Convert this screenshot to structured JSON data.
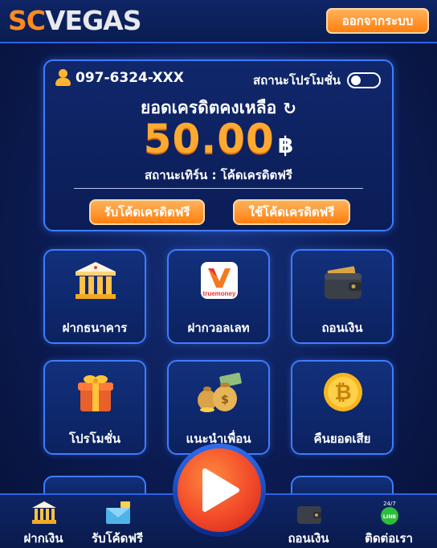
{
  "header": {
    "logo_sc": "SC",
    "logo_vegas": "VEGAS",
    "logout_label": "ออกจากระบบ"
  },
  "account": {
    "phone": "097-6324-XXX",
    "promo_label": "สถานะโปรโมชั่น",
    "promo_enabled": false,
    "credit_title": "ยอดเครดิตคงเหลือ",
    "balance": "50.00",
    "currency": "฿",
    "status_text": "สถานะเทิร์น : โค้ดเครดิตฟรี",
    "get_code_label": "รับโค้ดเครดิตฟรี",
    "use_code_label": "ใช้โค้ดเครดิตฟรี"
  },
  "menu": [
    {
      "label": "ฝากธนาคาร",
      "icon": "bank-icon"
    },
    {
      "label": "ฝากวอลเลท",
      "icon": "truemoney-icon",
      "icon_text": "truemoney"
    },
    {
      "label": "ถอนเงิน",
      "icon": "wallet-icon"
    },
    {
      "label": "โปรโมชั่น",
      "icon": "gift-icon"
    },
    {
      "label": "แนะนำเพื่อน",
      "icon": "money-bags-icon"
    },
    {
      "label": "คืนยอดเสีย",
      "icon": "bitcoin-icon"
    }
  ],
  "bottom_nav": [
    {
      "label": "ฝากเงิน",
      "icon": "bank-icon"
    },
    {
      "label": "รับโค้ดฟรี",
      "icon": "envelope-icon"
    },
    {
      "label": "ถอนเงิน",
      "icon": "wallet-icon"
    },
    {
      "label": "ติดต่อเรา",
      "icon": "line-icon",
      "badge": "24/7",
      "icon_text": "LINE"
    }
  ],
  "colors": {
    "accent": "#ff8a1e",
    "border": "#3f7cff",
    "background": "#0b1b52",
    "play": "#f24a2a"
  }
}
